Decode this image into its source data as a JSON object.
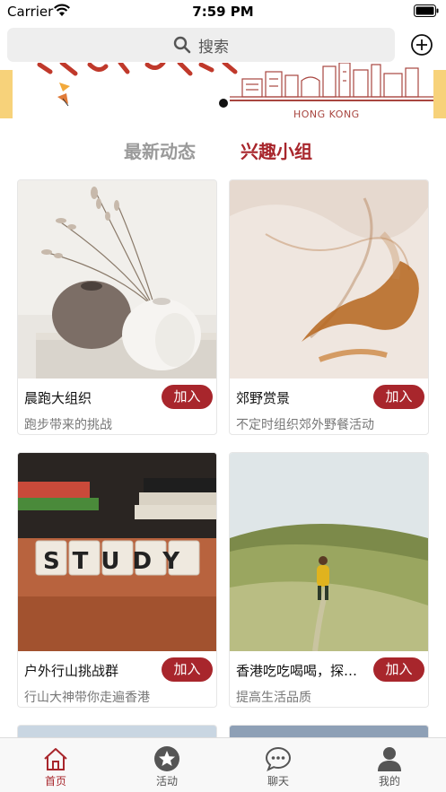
{
  "status_bar": {
    "carrier": "Carrier",
    "time": "7:59 PM"
  },
  "search": {
    "label": "搜索"
  },
  "banner": {
    "caption": "HONG KONG"
  },
  "tabs": [
    {
      "label": "最新动态",
      "active": false
    },
    {
      "label": "兴趣小组",
      "active": true
    }
  ],
  "groups": [
    {
      "name": "晨跑大组织",
      "desc": "跑步带来的挑战",
      "join_label": "加入"
    },
    {
      "name": "郊野赏景",
      "desc": "不定时组织郊外野餐活动",
      "join_label": "加入"
    },
    {
      "name": "户外行山挑战群",
      "desc": "行山大神带你走遍香港",
      "join_label": "加入"
    },
    {
      "name": "香港吃吃喝喝，探店打卡",
      "desc": "提高生活品质",
      "join_label": "加入"
    }
  ],
  "thumb_texts": {
    "study": "STUDY"
  },
  "tabbar": [
    {
      "label": "首页",
      "icon": "home-icon",
      "active": true
    },
    {
      "label": "活动",
      "icon": "star-icon",
      "active": false
    },
    {
      "label": "聊天",
      "icon": "chat-icon",
      "active": false
    },
    {
      "label": "我的",
      "icon": "person-icon",
      "active": false
    }
  ],
  "colors": {
    "accent": "#a8262c",
    "banner_edge": "#f7d27a",
    "inactive_tab": "#9a9a9a"
  }
}
